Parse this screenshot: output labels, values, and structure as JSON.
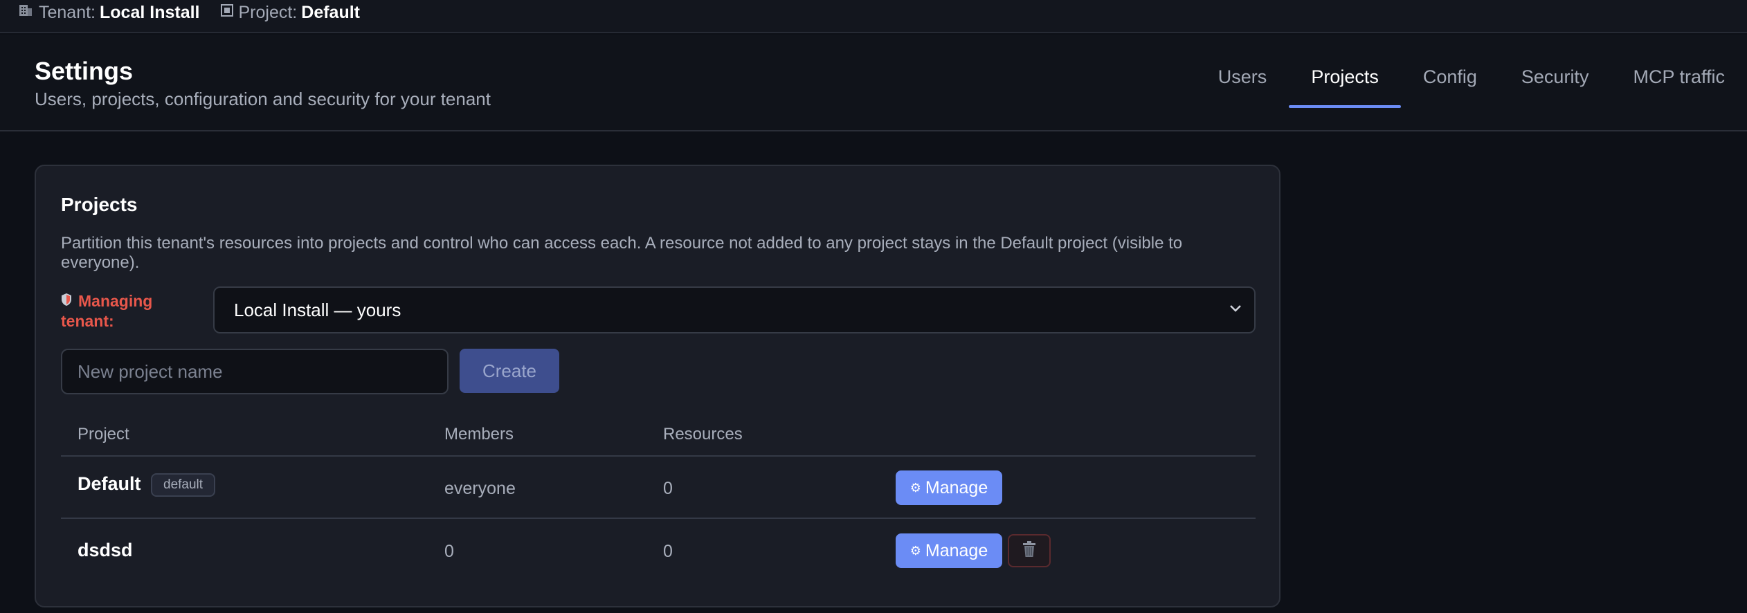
{
  "topbar": {
    "tenant_label": "Tenant:",
    "tenant_value": "Local Install",
    "project_label": "Project:",
    "project_value": "Default",
    "tenant_icon": "building-icon",
    "project_icon": "square-icon"
  },
  "header": {
    "title": "Settings",
    "subtitle": "Users, projects, configuration and security for your tenant",
    "tabs": [
      {
        "label": "Users",
        "active": false
      },
      {
        "label": "Projects",
        "active": true
      },
      {
        "label": "Config",
        "active": false
      },
      {
        "label": "Security",
        "active": false
      },
      {
        "label": "MCP traffic",
        "active": false
      }
    ]
  },
  "projects_card": {
    "title": "Projects",
    "description": "Partition this tenant's resources into projects and control who can access each. A resource not added to any project stays in the Default project (visible to everyone).",
    "managing_label": "Managing tenant:",
    "tenant_select_value": "Local Install — yours",
    "new_project_placeholder": "New project name",
    "create_label": "Create",
    "columns": [
      "Project",
      "Members",
      "Resources"
    ],
    "rows": [
      {
        "name": "Default",
        "badge": "default",
        "members": "everyone",
        "resources": "0",
        "manage_label": "Manage",
        "deletable": false
      },
      {
        "name": "dsdsd",
        "badge": "",
        "members": "0",
        "resources": "0",
        "manage_label": "Manage",
        "deletable": true
      }
    ]
  },
  "colors": {
    "accent": "#6b8cf5",
    "danger": "#e8574b",
    "background": "#0d1017",
    "card": "#1a1d26"
  }
}
